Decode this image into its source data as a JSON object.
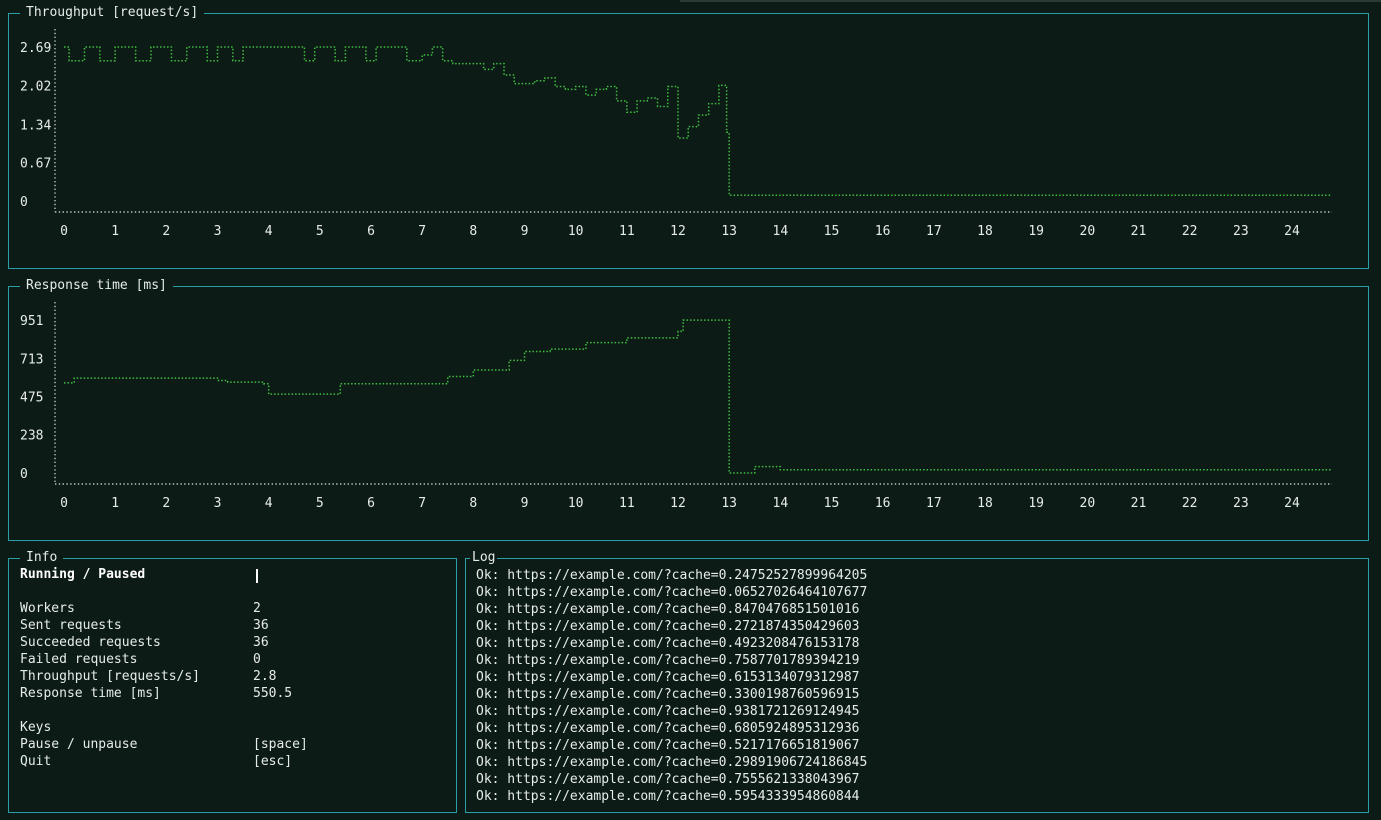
{
  "throughput": {
    "title": "Throughput [request/s]",
    "chart_data": {
      "type": "line",
      "title": "Throughput [request/s]",
      "xlabel": "",
      "ylabel": "",
      "ylim": [
        0,
        2.69
      ],
      "xlim": [
        0,
        25
      ],
      "y_ticks": [
        "2.69",
        "2.02",
        "1.34",
        "0.67",
        "0"
      ],
      "y_tick_values": [
        2.69,
        2.02,
        1.34,
        0.67,
        0
      ],
      "x_ticks": [
        "0",
        "1",
        "2",
        "3",
        "4",
        "5",
        "6",
        "7",
        "8",
        "9",
        "10",
        "11",
        "12",
        "13",
        "14",
        "15",
        "16",
        "17",
        "18",
        "19",
        "20",
        "21",
        "22",
        "23",
        "24"
      ],
      "color": "#3fbf3f",
      "x": [
        0,
        0.1,
        0.2,
        0.4,
        0.5,
        0.7,
        0.9,
        1.0,
        1.2,
        1.4,
        1.6,
        1.7,
        1.9,
        2.1,
        2.3,
        2.4,
        2.6,
        2.8,
        3.0,
        3.1,
        3.3,
        3.5,
        3.7,
        3.8,
        4.0,
        4.2,
        4.4,
        4.6,
        4.7,
        4.9,
        5.1,
        5.3,
        5.5,
        5.7,
        5.9,
        6.1,
        6.3,
        6.5,
        6.7,
        6.9,
        7.0,
        7.2,
        7.4,
        7.6,
        7.8,
        8.0,
        8.2,
        8.4,
        8.6,
        8.8,
        9.0,
        9.2,
        9.4,
        9.6,
        9.8,
        10.0,
        10.2,
        10.4,
        10.6,
        10.8,
        11.0,
        11.2,
        11.4,
        11.6,
        11.8,
        12.0,
        12.2,
        12.4,
        12.6,
        12.8,
        12.95,
        13.0,
        13.1,
        13.5,
        14,
        15,
        16,
        17,
        18,
        19,
        20,
        21,
        22,
        23,
        24,
        25
      ],
      "y": [
        2.69,
        2.45,
        2.45,
        2.69,
        2.69,
        2.45,
        2.45,
        2.69,
        2.69,
        2.45,
        2.45,
        2.69,
        2.69,
        2.45,
        2.45,
        2.69,
        2.69,
        2.45,
        2.69,
        2.69,
        2.45,
        2.69,
        2.69,
        2.69,
        2.69,
        2.69,
        2.69,
        2.69,
        2.45,
        2.69,
        2.69,
        2.45,
        2.69,
        2.69,
        2.45,
        2.69,
        2.69,
        2.69,
        2.45,
        2.45,
        2.55,
        2.69,
        2.45,
        2.4,
        2.4,
        2.4,
        2.3,
        2.4,
        2.2,
        2.05,
        2.05,
        2.1,
        2.15,
        2.0,
        1.95,
        2.0,
        1.85,
        1.95,
        2.0,
        1.75,
        1.55,
        1.75,
        1.8,
        1.65,
        2.0,
        1.1,
        1.3,
        1.5,
        1.7,
        2.02,
        1.2,
        0.1,
        0.1,
        0.1,
        0.1,
        0.1,
        0.1,
        0.1,
        0.1,
        0.1,
        0.1,
        0.1,
        0.1,
        0.1,
        0.1,
        0.1
      ]
    }
  },
  "response": {
    "title": "Response time [ms]",
    "chart_data": {
      "type": "line",
      "title": "Response time [ms]",
      "xlabel": "",
      "ylabel": "",
      "ylim": [
        0,
        951
      ],
      "xlim": [
        0,
        25
      ],
      "y_ticks": [
        "951",
        "713",
        "475",
        "238",
        "0"
      ],
      "y_tick_values": [
        951,
        713,
        475,
        238,
        0
      ],
      "x_ticks": [
        "0",
        "1",
        "2",
        "3",
        "4",
        "5",
        "6",
        "7",
        "8",
        "9",
        "10",
        "11",
        "12",
        "13",
        "14",
        "15",
        "16",
        "17",
        "18",
        "19",
        "20",
        "21",
        "22",
        "23",
        "24"
      ],
      "color": "#3fbf3f",
      "x": [
        0,
        0.2,
        1.0,
        2.0,
        2.5,
        3.0,
        3.2,
        3.9,
        4.0,
        4.5,
        5.2,
        5.4,
        6.0,
        7.0,
        7.5,
        7.6,
        8.0,
        8.2,
        8.7,
        9.0,
        9.5,
        9.8,
        10.2,
        10.5,
        11.0,
        11.5,
        12.0,
        12.1,
        12.9,
        13.0,
        13.5,
        13.9,
        14.0,
        15,
        16,
        17,
        18,
        19,
        20,
        21,
        22,
        23,
        24,
        25
      ],
      "y": [
        560,
        590,
        590,
        590,
        590,
        575,
        565,
        555,
        490,
        490,
        490,
        555,
        555,
        555,
        600,
        600,
        640,
        640,
        700,
        755,
        770,
        770,
        810,
        810,
        840,
        840,
        880,
        950,
        950,
        0,
        40,
        40,
        20,
        20,
        20,
        20,
        20,
        20,
        20,
        20,
        20,
        20,
        20,
        20
      ]
    }
  },
  "info": {
    "title": "Info",
    "status_label": "Running / Paused",
    "rows": [
      {
        "key": "Workers",
        "value": "2"
      },
      {
        "key": "Sent requests",
        "value": "36"
      },
      {
        "key": "Succeeded requests",
        "value": "36"
      },
      {
        "key": "Failed requests",
        "value": "0"
      },
      {
        "key": "Throughput [requests/s]",
        "value": "2.8"
      },
      {
        "key": "Response time [ms]",
        "value": "550.5"
      }
    ],
    "keys_heading": "Keys",
    "keys": [
      {
        "key": "Pause / unpause",
        "value": "[space]"
      },
      {
        "key": "Quit",
        "value": "[esc]"
      }
    ]
  },
  "log": {
    "title": "Log",
    "lines": [
      "Ok: https://example.com/?cache=0.24752527899964205",
      "Ok: https://example.com/?cache=0.06527026464107677",
      "Ok: https://example.com/?cache=0.8470476851501016",
      "Ok: https://example.com/?cache=0.2721874350429603",
      "Ok: https://example.com/?cache=0.4923208476153178",
      "Ok: https://example.com/?cache=0.7587701789394219",
      "Ok: https://example.com/?cache=0.6153134079312987",
      "Ok: https://example.com/?cache=0.3300198760596915",
      "Ok: https://example.com/?cache=0.9381721269124945",
      "Ok: https://example.com/?cache=0.6805924895312936",
      "Ok: https://example.com/?cache=0.5217176651819067",
      "Ok: https://example.com/?cache=0.29891906724186845",
      "Ok: https://example.com/?cache=0.7555621338043967",
      "Ok: https://example.com/?cache=0.5954333954860844"
    ]
  }
}
